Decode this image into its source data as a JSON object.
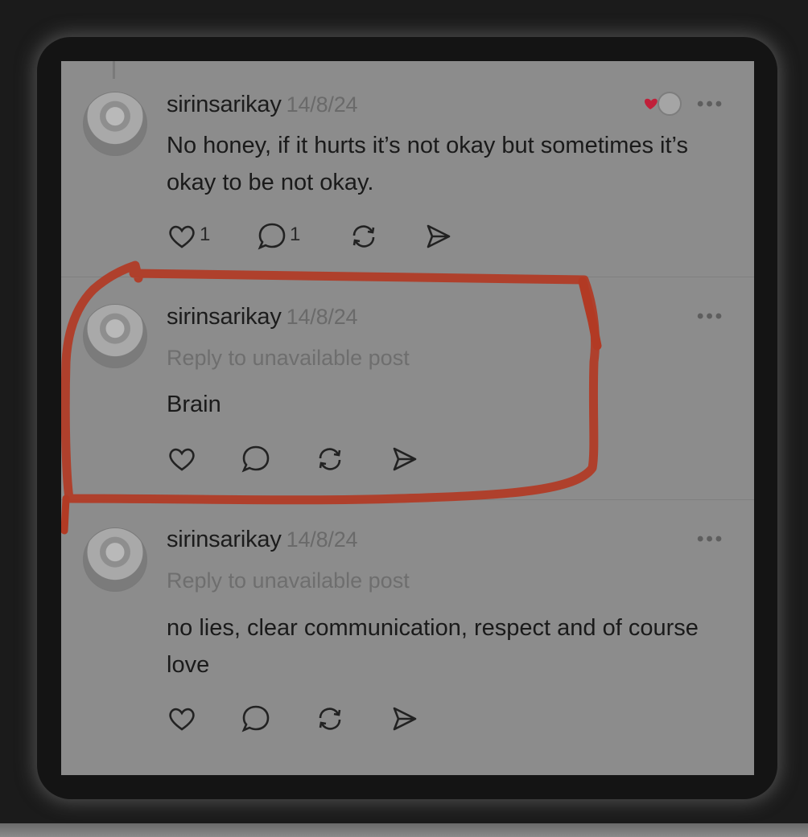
{
  "posts": [
    {
      "username": "sirinsarikay",
      "date": "14/8/24",
      "reply_note": "",
      "text": "No honey, if it hurts it’s not okay but sometimes it’s okay to be not okay.",
      "likes": "1",
      "replies": "1",
      "more": "•••"
    },
    {
      "username": "sirinsarikay",
      "date": "14/8/24",
      "reply_note": "Reply to unavailable post",
      "text": "Brain",
      "likes": "",
      "replies": "",
      "more": "•••"
    },
    {
      "username": "sirinsarikay",
      "date": "14/8/24",
      "reply_note": "Reply to unavailable post",
      "text": "no lies, clear communication, respect and of course love",
      "likes": "",
      "replies": "",
      "more": "•••"
    }
  ],
  "icons": [
    "heart-icon",
    "comment-icon",
    "repost-icon",
    "share-icon",
    "more-icon"
  ],
  "colors": {
    "annotation": "#b23a24",
    "liked_heart": "#c0203a",
    "screen_bg": "#8c8c8c"
  }
}
